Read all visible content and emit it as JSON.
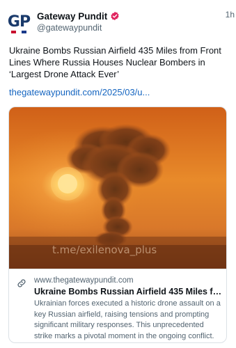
{
  "account": {
    "avatar_text": "GP",
    "display_name": "Gateway Pundit",
    "handle": "@gatewaypundit",
    "verified_color": "#e0245e"
  },
  "post": {
    "time": "1h",
    "text": "Ukraine Bombs Russian Airfield 435 Miles from Front Lines Where Russia Houses Nuclear Bombers in ‘Largest Drone Attack Ever’",
    "link": "thegatewaypundit.com/2025/03/u..."
  },
  "card": {
    "watermark": "t.me/exilenova_plus",
    "domain": "www.thegatewaypundit.com",
    "title": "Ukraine Bombs Russian Airfield 435 Miles from...",
    "description": "Ukrainian forces executed a historic drone assault on a key Russian airfield, raising tensions and prompting significant military responses. This unprecedented strike marks a pivotal moment in the ongoing conflict."
  },
  "icons": {
    "verified": "verified-badge-icon",
    "link": "link-chain-icon"
  },
  "colors": {
    "link": "#1565c0",
    "text": "#0f1419",
    "muted": "#536471",
    "border": "#dbe1e6"
  }
}
